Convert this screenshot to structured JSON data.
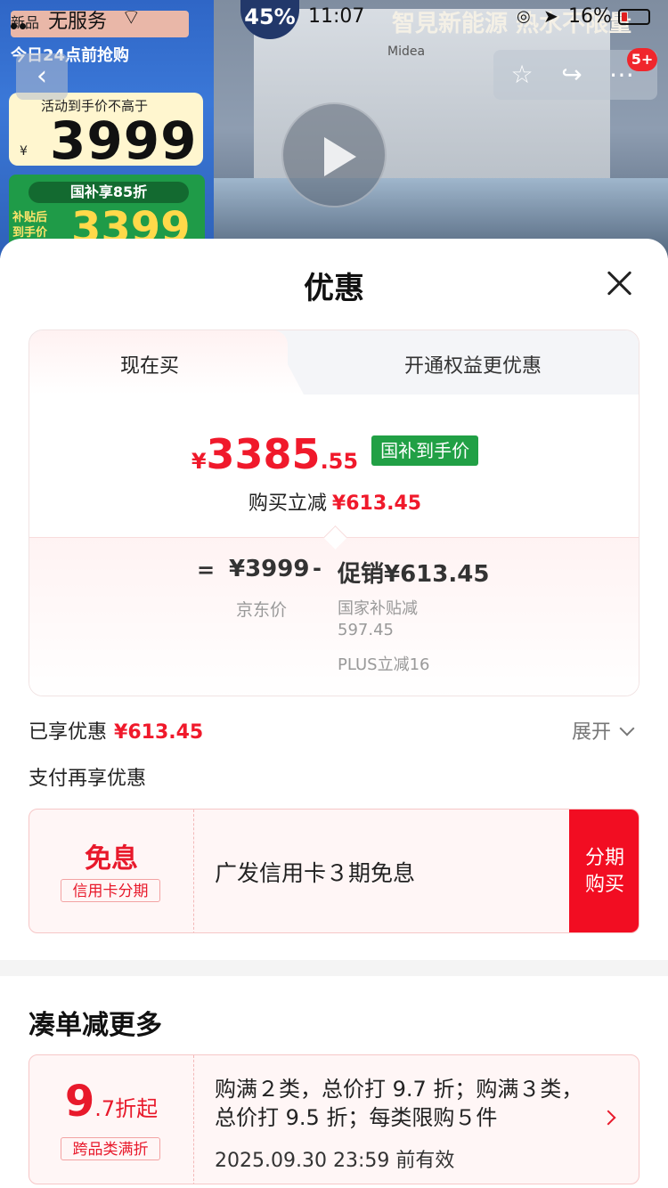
{
  "status_bar": {
    "carrier": "无服务",
    "time": "11:07",
    "battery": "16%"
  },
  "background": {
    "badge_new": "新品",
    "promo_today": "今日24点前抢购",
    "price_label": "活动到手价不高于",
    "price_currency": "¥",
    "price_value": "3999",
    "gov_label": "国补享85折",
    "subsidy_label": "补贴后到手价",
    "subsidy_price": "3399",
    "percent": "45%",
    "headline": "智見新能源 热水不限量",
    "brand": "Midea",
    "notif_count": "5+"
  },
  "sheet": {
    "title": "优惠",
    "tabs": [
      "现在买",
      "开通权益更优惠"
    ],
    "price": {
      "currency": "¥",
      "integer": "3385",
      "decimal": ".55",
      "tag": "国补到手价"
    },
    "save_label": "购买立减",
    "save_amount": "¥613.45",
    "breakdown": {
      "equals": "=",
      "jd_price": "¥3999",
      "jd_label": "京东价",
      "minus": "-",
      "promo": "促销¥613.45",
      "sub1_line1": "国家补贴减",
      "sub1_line2": "597.45",
      "sub2": "PLUS立减16"
    },
    "enjoyed_label": "已享优惠",
    "enjoyed_amount": "¥613.45",
    "expand_label": "展开",
    "pay_title": "支付再享优惠",
    "pay_offer": {
      "highlight": "免息",
      "tag": "信用卡分期",
      "desc": "广发信用卡３期免息",
      "button_line1": "分期",
      "button_line2": "购买"
    },
    "more_title": "凑单减更多",
    "more_offer": {
      "discount_num": "9",
      "discount_suffix": ".7折起",
      "tag": "跨品类满折",
      "desc": "购满２类，总价打 9.7 折；购满３类，总价打 9.5 折；每类限购５件",
      "date": "2025.09.30 23:59 前有效"
    }
  }
}
